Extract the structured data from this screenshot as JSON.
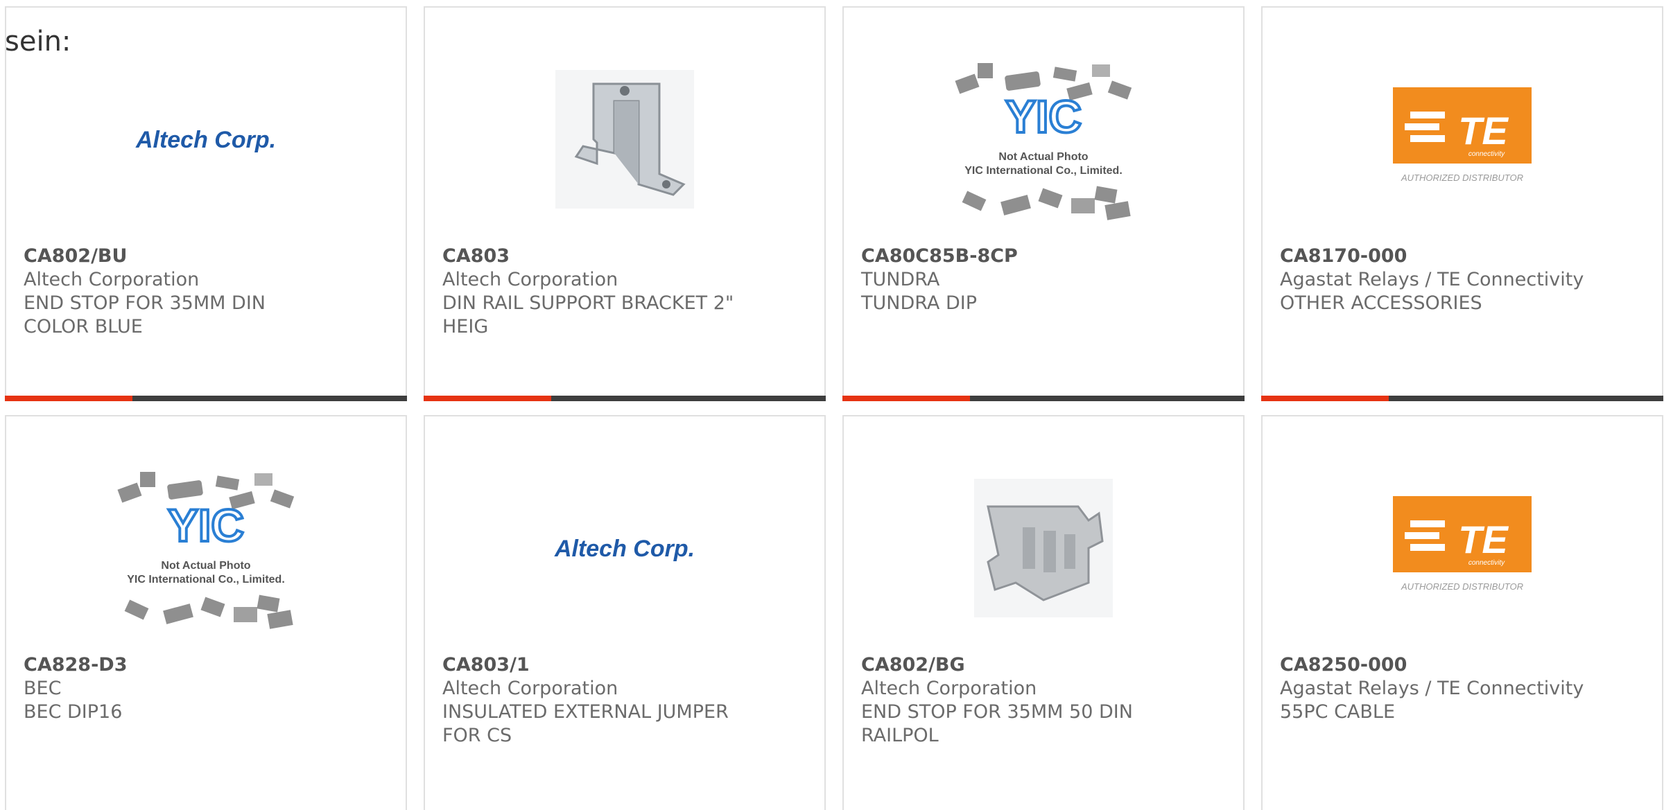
{
  "intro_text": "sein:",
  "colors": {
    "accent": "#e63312",
    "bar": "#3e3e3e",
    "altech_blue": "#1f5aa8",
    "te_orange": "#f28c1e",
    "yic_blue": "#2a7fd4"
  },
  "logos": {
    "altech": "Altech Corp.",
    "te": "TE",
    "te_sub": "connectivity",
    "te_badge": "AUTHORIZED DISTRIBUTOR",
    "yic": "YIC",
    "yic_line1": "Not Actual Photo",
    "yic_line2": "YIC International Co., Limited."
  },
  "products": [
    {
      "part": "CA802/BU",
      "maker": "Altech Corporation",
      "desc1": "END STOP FOR 35MM DIN",
      "desc2": "COLOR BLUE",
      "image": "altech-logo"
    },
    {
      "part": "CA803",
      "maker": "Altech Corporation",
      "desc1": "DIN RAIL SUPPORT BRACKET 2\"",
      "desc2": "HEIG",
      "image": "bracket-photo"
    },
    {
      "part": "CA80C85B-8CP",
      "maker": "TUNDRA",
      "desc1": "TUNDRA DIP",
      "desc2": "",
      "image": "yic-placeholder"
    },
    {
      "part": "CA8170-000",
      "maker": "Agastat Relays / TE Connectivity",
      "desc1": "OTHER ACCESSORIES",
      "desc2": "",
      "image": "te-logo"
    },
    {
      "part": "CA828-D3",
      "maker": "BEC",
      "desc1": "BEC DIP16",
      "desc2": "",
      "image": "yic-placeholder"
    },
    {
      "part": "CA803/1",
      "maker": "Altech Corporation",
      "desc1": "INSULATED EXTERNAL JUMPER",
      "desc2": "FOR CS",
      "image": "altech-logo"
    },
    {
      "part": "CA802/BG",
      "maker": "Altech Corporation",
      "desc1": "END STOP FOR 35MM 50 DIN",
      "desc2": "RAILPOL",
      "image": "end-stop-photo"
    },
    {
      "part": "CA8250-000",
      "maker": "Agastat Relays / TE Connectivity",
      "desc1": "55PC CABLE",
      "desc2": "",
      "image": "te-logo"
    }
  ]
}
